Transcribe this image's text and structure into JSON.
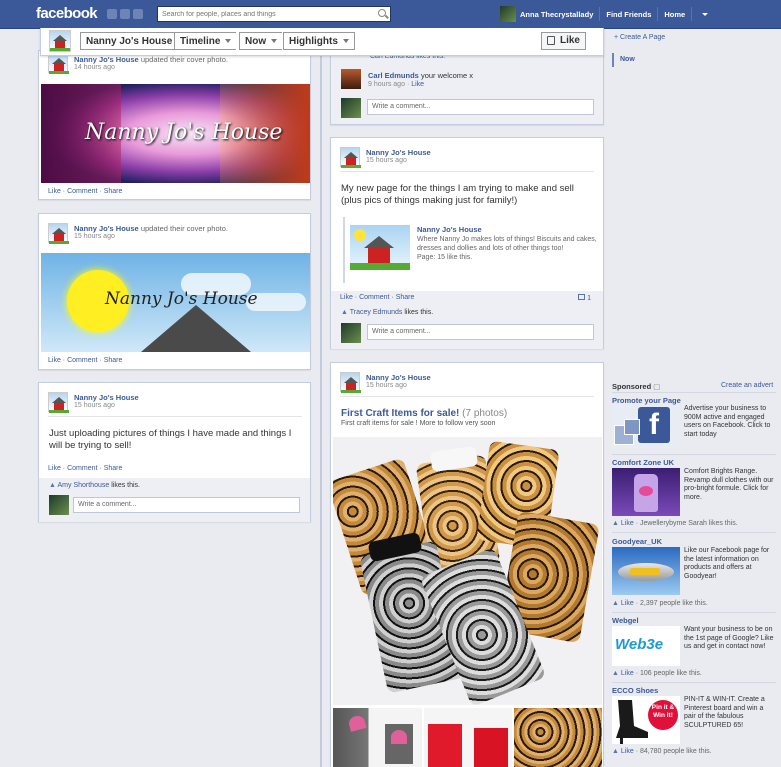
{
  "topbar": {
    "logo": "facebook",
    "search_placeholder": "Search for people, places and things",
    "user_name": "Anna Thecrystallady",
    "find_friends": "Find Friends",
    "home": "Home"
  },
  "pagebar": {
    "page_name": "Nanny Jo's House",
    "timeline": "Timeline",
    "now": "Now",
    "highlights": "Highlights",
    "like": "Like"
  },
  "page_name": "Nanny Jo's House",
  "posts": {
    "p1": {
      "action": "updated their cover photo.",
      "time": "14 hours ago",
      "cover_text": "Nanny Jo's House"
    },
    "p2": {
      "action": "updated their cover photo.",
      "time": "15 hours ago",
      "cover_text": "Nanny Jo's House"
    },
    "p3": {
      "time": "15 hours ago",
      "text": "Just uploading pictures of things I have made and things I will be trying to sell!",
      "liker": "Amy Shorthouse",
      "likes_this": "likes this."
    },
    "p4": {
      "top_likers": "Carl Edmunds likes this.",
      "comment_author": "Carl Edmunds",
      "comment_text": "your welcome x",
      "comment_time": "9 hours ago",
      "comment_like": "Like"
    },
    "p5": {
      "time": "15 hours ago",
      "text": "My new page for the things I am trying to make and sell (plus pics of things making just for family!)",
      "shared_name": "Nanny Jo's House",
      "shared_desc": "Where Nanny Jo makes lots of things! Biscuits and cakes, dresses and dollies and lots of other things too!",
      "shared_meta": "Page: 15 like this.",
      "liker": "Tracey Edmunds",
      "likes_this": "likes this.",
      "comment_count": "1"
    },
    "p6": {
      "time": "15 hours ago",
      "album_title": "First Craft Items for sale!",
      "album_count": "(7 photos)",
      "album_desc": "First craft items for sale ! More to follow very soon"
    }
  },
  "actions": {
    "like": "Like",
    "comment": "Comment",
    "share": "Share",
    "write_comment": "Write a comment...",
    "sep": "·"
  },
  "right": {
    "create_page": "+ Create A Page",
    "now": "Now",
    "sponsored": "Sponsored",
    "create_advert": "Create an advert"
  },
  "ads": [
    {
      "title": "Promote your Page",
      "text": "Advertise your business to 900M active and engaged users on Facebook. Click to start today",
      "likes": ""
    },
    {
      "title": "Comfort Zone UK",
      "text": "Comfort Brights Range. Revamp dull clothes with our pro-bright formule. Click for more.",
      "likes": "Jewellerybyme Sarah likes this."
    },
    {
      "title": "Goodyear_UK",
      "text": "Like our Facebook page for the latest information on products and offers at Goodyear!",
      "likes": "2,397 people like this."
    },
    {
      "title": "Webgel",
      "text": "Want your business to be on the 1st page of Google? Like us and get in contact now!",
      "likes": "106 people like this."
    },
    {
      "title": "ECCO Shoes",
      "text": "PIN-IT & WIN-IT. Create a Pinterest board and win a pair of the fabulous SCULPTURED 65!",
      "likes": "84,780 people like this."
    }
  ],
  "ad_images": {
    "webgel": "Web3e",
    "ecco": "Pin it & Win it!"
  },
  "colors": {
    "brand": "#3b5998",
    "topbar_border": "#29447e",
    "feed_bg": "#e9ebf1"
  }
}
